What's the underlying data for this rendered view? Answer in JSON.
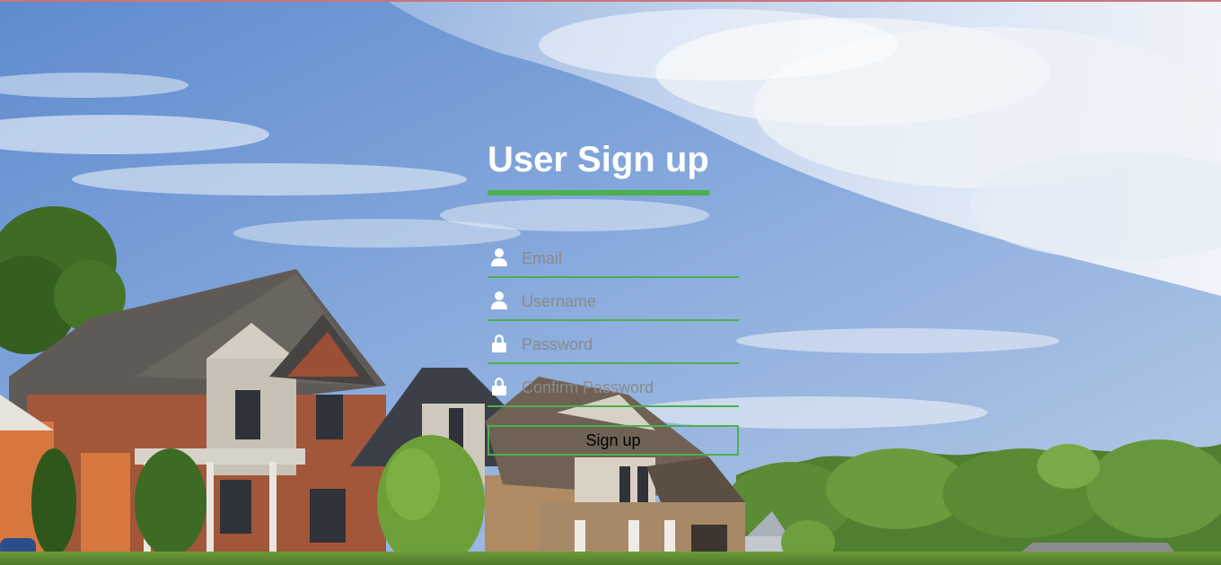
{
  "page": {
    "title": "User Sign up"
  },
  "form": {
    "fields": [
      {
        "name": "email",
        "placeholder": "Email",
        "value": "",
        "icon": "user-icon"
      },
      {
        "name": "username",
        "placeholder": "Username",
        "value": "",
        "icon": "user-icon"
      },
      {
        "name": "password",
        "placeholder": "Password",
        "value": "",
        "icon": "lock-icon"
      },
      {
        "name": "confirm_password",
        "placeholder": "Confirm Password",
        "value": "",
        "icon": "lock-icon"
      }
    ],
    "submit_label": "Sign up"
  },
  "colors": {
    "accent": "#4caf50",
    "title_text": "#ffffff",
    "placeholder_text": "#8a8a8a",
    "top_line": "#c9757b"
  }
}
